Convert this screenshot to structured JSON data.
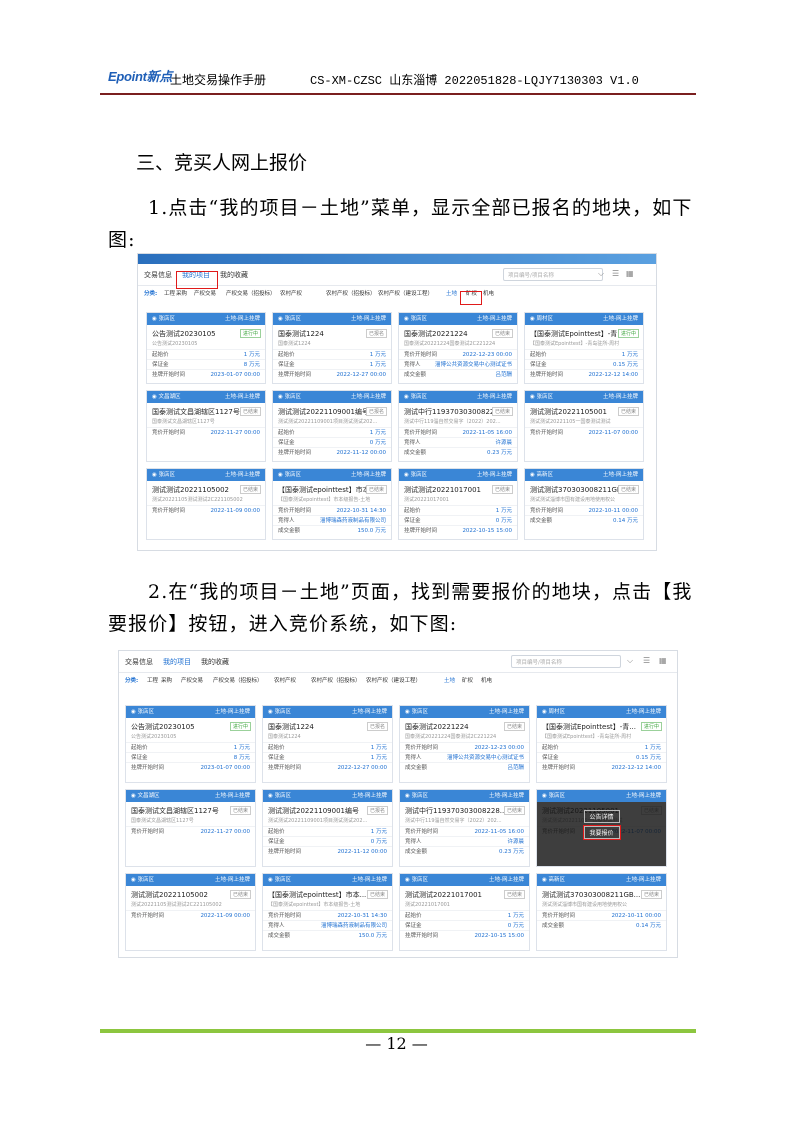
{
  "header": {
    "logo": "Epoint新点",
    "manual_title": "土地交易操作手册",
    "doc_code": "CS-XM-CZSC 山东淄博 2022051828-LQJY7130303   V1.0"
  },
  "section_heading": "三、竞买人网上报价",
  "step1": "1.点击“我的项目－土地”菜单，显示全部已报名的地块，如下图:",
  "step2": "2.在“我的项目－土地”页面，找到需要报价的地块，点击【我要报价】按钮，进入竞价系统，如下图:",
  "screenshot": {
    "tabs": [
      "交易信息",
      "我的项目",
      "我的收藏"
    ],
    "search_placeholder": "项目编号/项目名称",
    "categories_lead": "分类:",
    "categories": [
      "工程",
      "采购",
      "产权交易",
      "产权交易（招投标）",
      "农村产权",
      "农村产权（招投标）",
      "农村产权（建设工程）",
      "土地",
      "矿权",
      "机电"
    ],
    "overlay_buttons": [
      "公告详情",
      "我要报价"
    ],
    "labels": {
      "start_price": "起始价",
      "deposit": "保证金",
      "listing_start": "挂牌开始时间",
      "bid_start": "竞价开始时间",
      "bidder": "竞得人",
      "deal_amount": "成交金额",
      "type": "土地-网上挂牌"
    },
    "cards": [
      {
        "region": "张店区",
        "title": "公告测试20230105",
        "sub": "公告测试20230105",
        "badge": "进行中",
        "rows": [
          [
            "start_price",
            "1 万元"
          ],
          [
            "deposit",
            "8 万元"
          ],
          [
            "listing_start",
            "2023-01-07 00:00"
          ]
        ]
      },
      {
        "region": "张店区",
        "title": "国泰测试1224",
        "sub": "国泰测试1224",
        "badge": "已报名",
        "rows": [
          [
            "start_price",
            "1 万元"
          ],
          [
            "deposit",
            "1 万元"
          ],
          [
            "listing_start",
            "2022-12-27 00:00"
          ]
        ]
      },
      {
        "region": "张店区",
        "title": "国泰测试20221224",
        "sub": "国泰测试20221224国泰测试2C221224",
        "badge": "已结束",
        "rows": [
          [
            "bid_start",
            "2022-12-23 00:00"
          ],
          [
            "bidder",
            "淄博公共资源交易中心测试证书"
          ],
          [
            "deal_amount",
            "吕范酬"
          ]
        ]
      },
      {
        "region": "周村区",
        "title": "【国泰测试Epointtest】-青...",
        "sub": "【国泰测试Epointtest】-青岛驻所-周村",
        "badge": "进行中",
        "rows": [
          [
            "start_price",
            "1 万元"
          ],
          [
            "deposit",
            "0.15 万元"
          ],
          [
            "listing_start",
            "2022-12-12 14:00"
          ]
        ]
      },
      {
        "region": "文昌湖区",
        "title": "国泰测试文昌湖辖区1127号",
        "sub": "国泰测试文昌湖辖区1127号",
        "badge": "已结束",
        "rows": [
          [
            "bid_start",
            "2022-11-27 00:00"
          ]
        ]
      },
      {
        "region": "张店区",
        "title": "测试测试20221109001编号",
        "sub": "测试测试20221109001项目测试测试202...",
        "badge": "已报名",
        "rows": [
          [
            "start_price",
            "1 万元"
          ],
          [
            "deposit",
            "0 万元"
          ],
          [
            "listing_start",
            "2022-11-12 00:00"
          ]
        ]
      },
      {
        "region": "张店区",
        "title": "测试中行119370303008228...",
        "sub": "测试中行119淄自然交易字（2022）202...",
        "badge": "已结束",
        "rows": [
          [
            "bid_start",
            "2022-11-05 16:00"
          ],
          [
            "bidder",
            "许源晨"
          ],
          [
            "deal_amount",
            "0.23 万元"
          ]
        ]
      },
      {
        "region": "张店区",
        "title": "测试测试20221105001",
        "sub": "测试测试20221105一国泰测试测试",
        "badge": "已结束",
        "rows": [
          [
            "bid_start",
            "2022-11-07 00:00"
          ]
        ]
      },
      {
        "region": "张店区",
        "title": "测试测试20221105002",
        "sub": "测试20221105测试测试2C221105002",
        "badge": "已结束",
        "rows": [
          [
            "bid_start",
            "2022-11-09 00:00"
          ]
        ]
      },
      {
        "region": "张店区",
        "title": "【国泰测试epointtest】市本...",
        "sub": "【国泰测试epointtest】市本级报告-土地",
        "badge": "已结束",
        "rows": [
          [
            "bid_start",
            "2022-10-31 14:30"
          ],
          [
            "bidder",
            "淄博瑞森药液制品有限公司"
          ],
          [
            "deal_amount",
            "150.0 万元"
          ]
        ]
      },
      {
        "region": "张店区",
        "title": "测试测试20221017001",
        "sub": "测试20221017001",
        "badge": "已结束",
        "rows": [
          [
            "start_price",
            "1 万元"
          ],
          [
            "deposit",
            "0 万元"
          ],
          [
            "listing_start",
            "2022-10-15 15:00"
          ]
        ]
      },
      {
        "region": "高新区",
        "title": "测试测试370303008211GB...",
        "sub": "测试测试淄博市国有建设用地使用权公",
        "badge": "已结束",
        "rows": [
          [
            "bid_start",
            "2022-10-11 00:00"
          ],
          [
            "deal_amount",
            "0.14 万元"
          ]
        ]
      }
    ]
  },
  "page_number": "— 12 —"
}
